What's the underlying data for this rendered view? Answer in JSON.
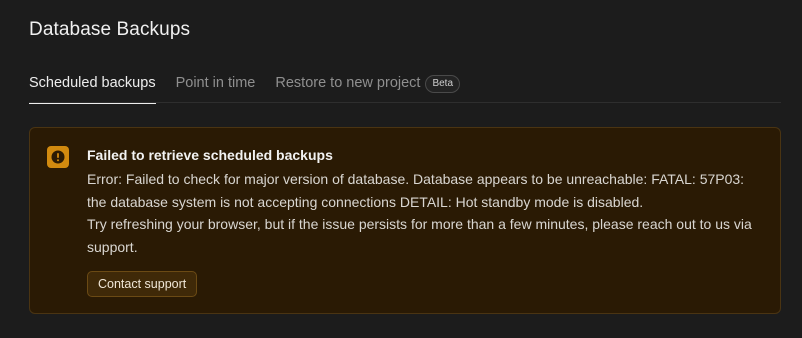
{
  "page": {
    "title": "Database Backups"
  },
  "tabs": [
    {
      "label": "Scheduled backups",
      "active": true
    },
    {
      "label": "Point in time",
      "active": false
    },
    {
      "label": "Restore to new project",
      "active": false,
      "badge": "Beta"
    }
  ],
  "alert": {
    "icon": "warning-icon",
    "title": "Failed to retrieve scheduled backups",
    "error_line": "Error: Failed to check for major version of database. Database appears to be unreachable: FATAL: 57P03: the database system is not accepting connections DETAIL: Hot standby mode is disabled.",
    "help_line": "Try refreshing your browser, but if the issue persists for more than a few minutes, please reach out to us via support.",
    "button_label": "Contact support"
  },
  "colors": {
    "background": "#1c1c1c",
    "alert_bg": "#2a1a04",
    "alert_border": "#4a3412",
    "warning_accent": "#d18a0f"
  }
}
